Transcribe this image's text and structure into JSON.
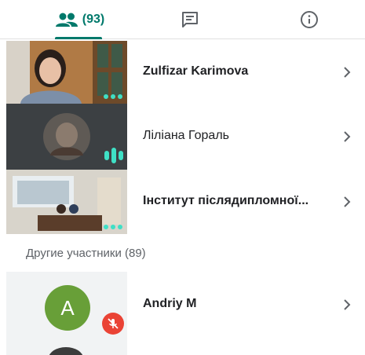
{
  "tabs": {
    "people_count": "(93)",
    "icons": [
      "people-icon",
      "chat-icon",
      "info-icon"
    ]
  },
  "participants": [
    {
      "name": "Zulfizar Karimova"
    },
    {
      "name": "Ліліана Гораль"
    },
    {
      "name": "Інститут післядипломної..."
    }
  ],
  "other_section": {
    "label": "Другие участники (89)"
  },
  "others": [
    {
      "name": "Andriy M",
      "initial": "A",
      "avatar_color": "#689f38"
    }
  ],
  "colors": {
    "accent": "#00796b",
    "dots": "#3fe0c5",
    "mute": "#ea4335"
  }
}
